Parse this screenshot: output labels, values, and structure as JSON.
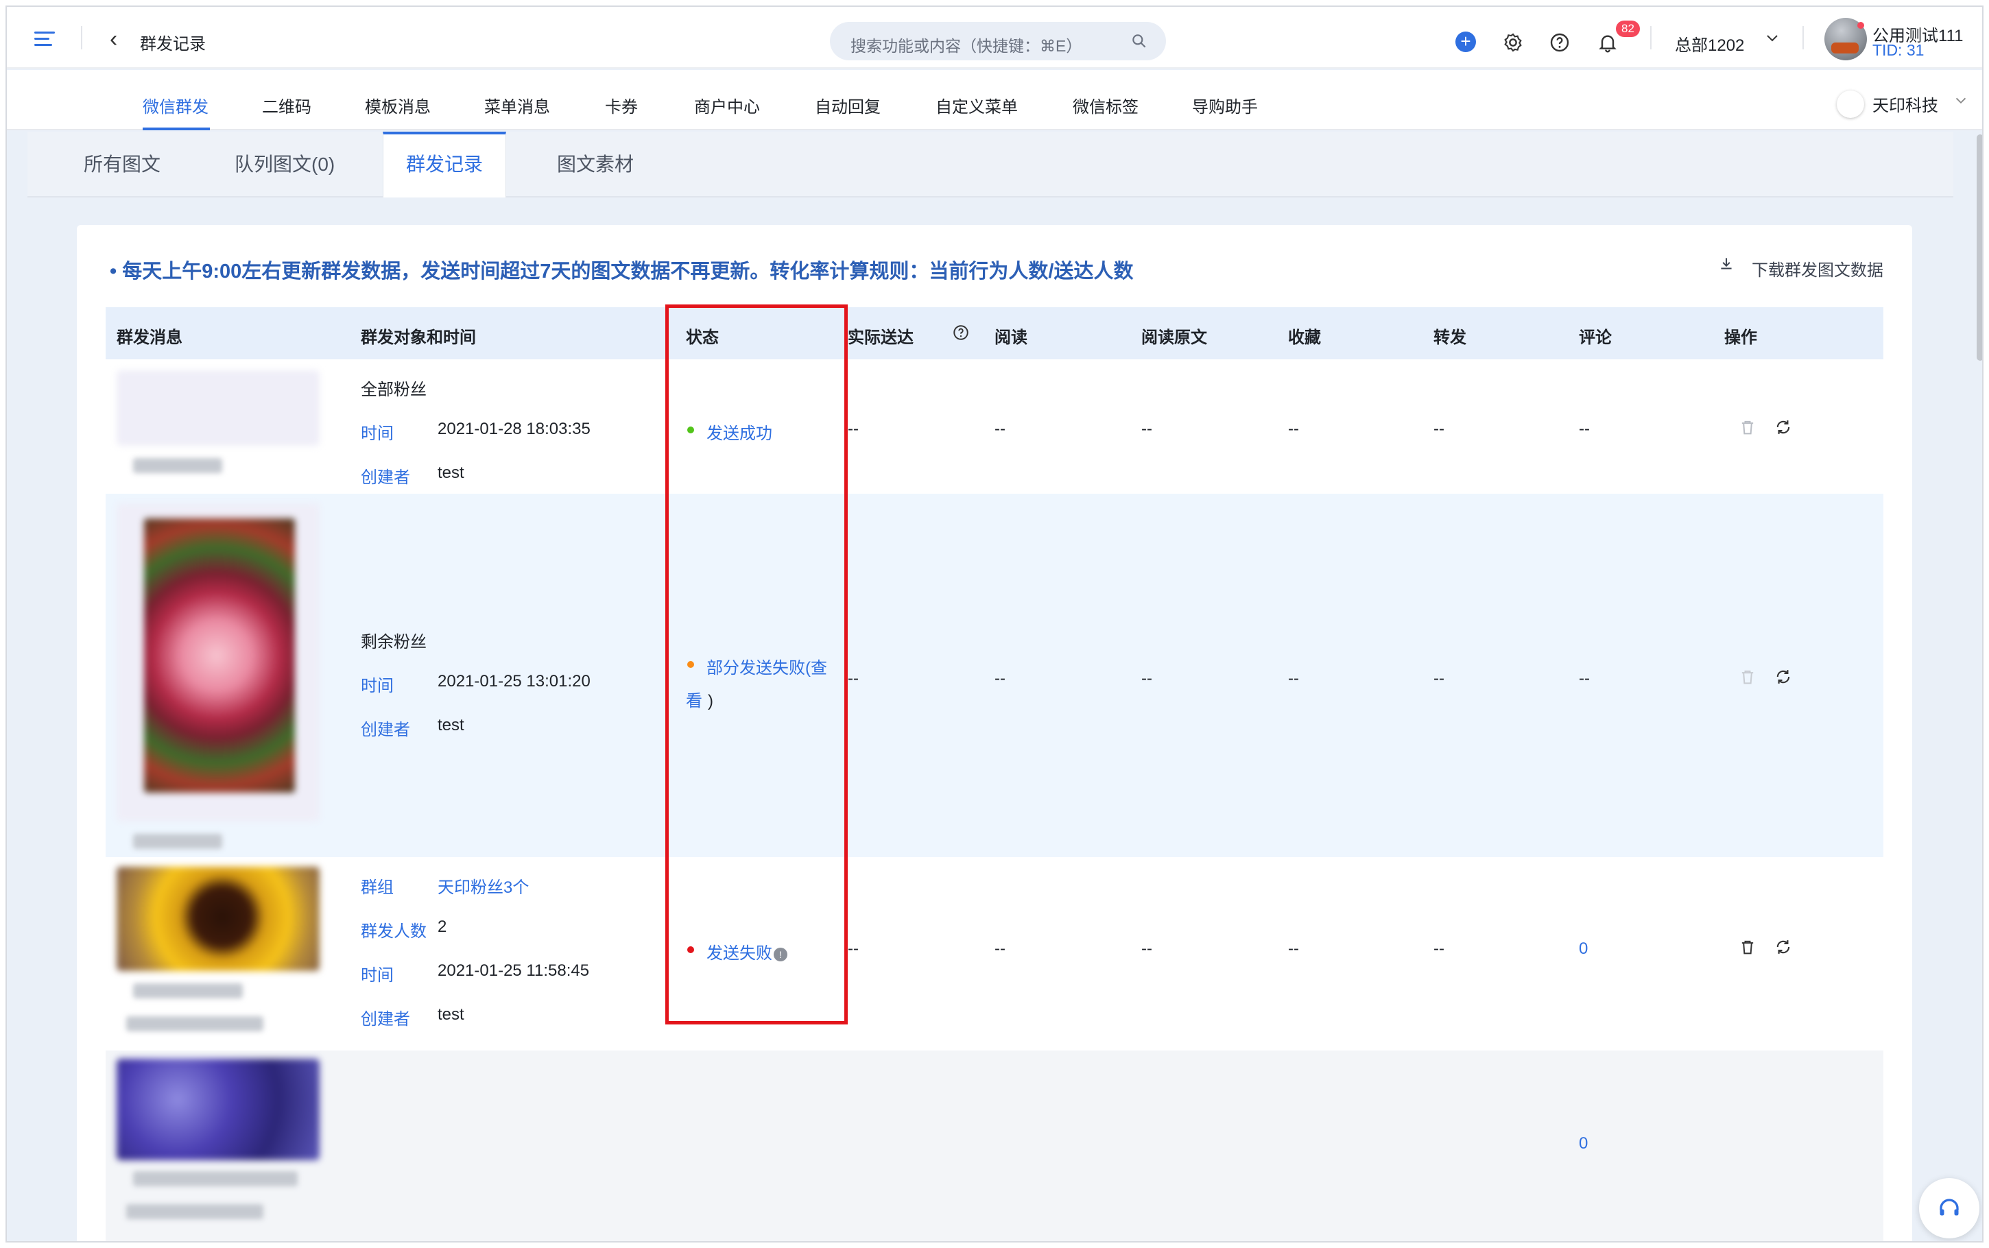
{
  "topbar": {
    "page_title": "群发记录",
    "search_placeholder": "搜索功能或内容（快捷键：⌘E）",
    "notification_count": "82",
    "org_name": "总部1202",
    "user_name": "公用测试111",
    "user_tid": "TID: 31"
  },
  "nav": {
    "items": [
      "微信群发",
      "二维码",
      "模板消息",
      "菜单消息",
      "卡券",
      "商户中心",
      "自动回复",
      "自定义菜单",
      "微信标签",
      "导购助手"
    ],
    "company": "天印科技"
  },
  "tabs": [
    "所有图文",
    "队列图文(0)",
    "群发记录",
    "图文素材"
  ],
  "notice": "• 每天上午9:00左右更新群发数据，发送时间超过7天的图文数据不再更新。转化率计算规则：当前行为人数/送达人数",
  "download_label": "下载群发图文数据",
  "table": {
    "headers": [
      "群发消息",
      "群发对象和时间",
      "状态",
      "实际送达",
      "阅读",
      "阅读原文",
      "收藏",
      "转发",
      "评论",
      "操作"
    ],
    "rows": [
      {
        "target": "全部粉丝",
        "time_label": "时间",
        "time": "2021-01-28 18:03:35",
        "creator_label": "创建者",
        "creator": "test",
        "status": "发送成功",
        "status_color": "#52c41a",
        "delivered": "--",
        "read": "--",
        "read_origin": "--",
        "favorite": "--",
        "forward": "--",
        "comment": "--"
      },
      {
        "target": "剩余粉丝",
        "time_label": "时间",
        "time": "2021-01-25 13:01:20",
        "creator_label": "创建者",
        "creator": "test",
        "status_line1": "部分发送失败(查",
        "status_line2": "看",
        "status_line2_suffix": ")",
        "status_color": "#fa8c16",
        "delivered": "--",
        "read": "--",
        "read_origin": "--",
        "favorite": "--",
        "forward": "--",
        "comment": "--"
      },
      {
        "group_label": "群组",
        "group_value": "天印粉丝3个",
        "count_label": "群发人数",
        "count": "2",
        "time_label": "时间",
        "time": "2021-01-25 11:58:45",
        "creator_label": "创建者",
        "creator": "test",
        "status": "发送失败",
        "status_info": "!",
        "status_color": "#e3141b",
        "delivered": "--",
        "read": "--",
        "read_origin": "--",
        "favorite": "--",
        "forward": "--",
        "comment": "0"
      },
      {
        "comment": "0"
      }
    ]
  },
  "colors": {
    "accent": "#2f6fe0",
    "highlight_box": "#e3141b"
  }
}
